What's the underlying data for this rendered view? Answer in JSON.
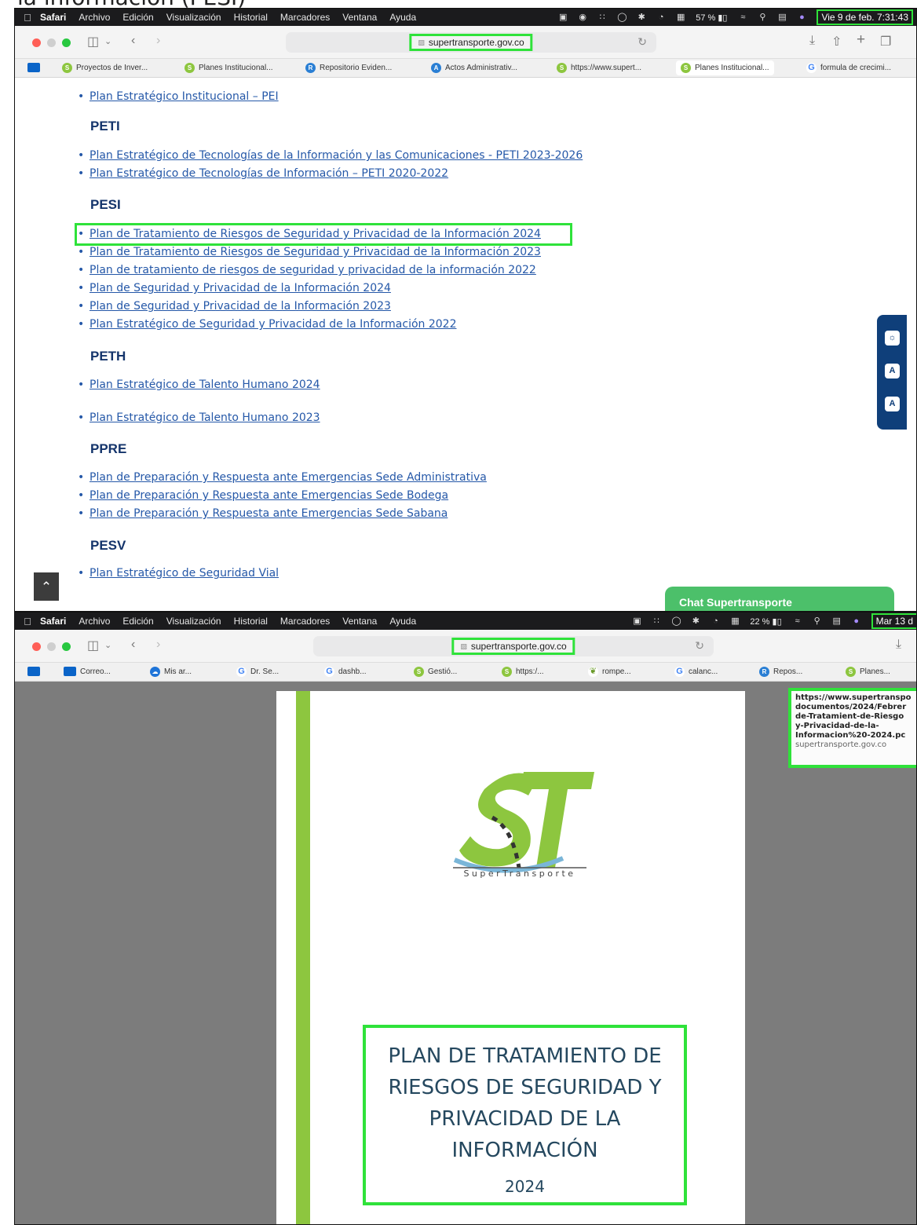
{
  "caption": "la información (PESI)",
  "shot1": {
    "menubar": {
      "items": [
        "Safari",
        "Archivo",
        "Edición",
        "Visualización",
        "Historial",
        "Marcadores",
        "Ventana",
        "Ayuda"
      ],
      "battery": "57 %",
      "clock": "Vie 9 de feb. 7:31:43"
    },
    "address": "supertransporte.gov.co",
    "bookmarks": [
      "Proyectos de Inver...",
      "Planes Institucional...",
      "Repositorio Eviden...",
      "Actos Administrativ...",
      "https://www.supert...",
      "Planes Institucional...",
      "formula de crecimi..."
    ],
    "page": {
      "pei_link": "Plan Estratégico Institucional – PEI",
      "sections": {
        "peti": {
          "heading": "PETI",
          "links": [
            "Plan Estratégico de Tecnologías de la Información y las Comunicaciones - PETI 2023-2026",
            "Plan Estratégico de Tecnologías de Información – PETI 2020-2022"
          ]
        },
        "pesi": {
          "heading": "PESI",
          "links": [
            "Plan de Tratamiento de Riesgos de Seguridad y Privacidad de la Información 2024",
            "Plan de Tratamiento de Riesgos de Seguridad y Privacidad de la Información 2023",
            "Plan de tratamiento de riesgos de seguridad y privacidad de la información 2022",
            "Plan de Seguridad y Privacidad de la Información 2024",
            "Plan de Seguridad y Privacidad de la Información 2023",
            "Plan Estratégico de Seguridad y Privacidad de la Información 2022"
          ]
        },
        "peth": {
          "heading": "PETH",
          "links": [
            "Plan Estratégico de Talento Humano 2024",
            "Plan Estratégico de Talento Humano 2023"
          ]
        },
        "ppre": {
          "heading": "PPRE",
          "links": [
            "Plan de Preparación y Respuesta ante Emergencias Sede Administrativa",
            "Plan de Preparación y Respuesta ante Emergencias Sede Bodega",
            "Plan de Preparación y Respuesta ante Emergencias Sede Sabana"
          ]
        },
        "pesv": {
          "heading": "PESV",
          "links": [
            "Plan Estratégico de Seguridad Vial"
          ]
        }
      },
      "chat": "Chat Supertransporte"
    }
  },
  "shot2": {
    "menubar": {
      "items": [
        "Safari",
        "Archivo",
        "Edición",
        "Visualización",
        "Historial",
        "Marcadores",
        "Ventana",
        "Ayuda"
      ],
      "battery": "22 %",
      "clock": "Mar 13 d"
    },
    "address": "supertransporte.gov.co",
    "bookmarks": [
      "Correo...",
      "Mis ar...",
      "Dr. Se...",
      "dashb...",
      "Gestió...",
      "https:/...",
      "rompe...",
      "calanc...",
      "Repos...",
      "Planes..."
    ],
    "tooltip": {
      "url": "https://www.supertranspo documentos/2024/Febrer de-Tratamient-de-Riesgo y-Privacidad-de-la-Informacion%20-2024.pc",
      "domain": "supertransporte.gov.co"
    },
    "pdf": {
      "logo_text": "SuperTransporte",
      "title": "PLAN DE TRATAMIENTO DE RIESGOS DE SEGURIDAD Y PRIVACIDAD DE LA INFORMACIÓN",
      "year": "2024"
    }
  },
  "colors": {
    "highlight": "#2fe23a",
    "link": "#2558a8",
    "heading": "#14346b",
    "chat": "#4cc06a",
    "logo_green": "#8dc63f"
  }
}
